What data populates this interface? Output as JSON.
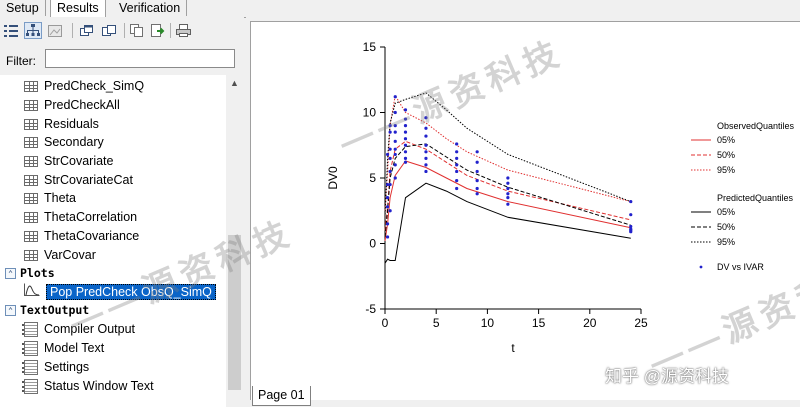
{
  "tabs": [
    {
      "label": "Setup"
    },
    {
      "label": "Results"
    },
    {
      "label": "Verification"
    }
  ],
  "filter": {
    "label": "Filter:",
    "value": ""
  },
  "tree": {
    "tables": [
      "PredCheck_SimQ",
      "PredCheckAll",
      "Residuals",
      "Secondary",
      "StrCovariate",
      "StrCovariateCat",
      "Theta",
      "ThetaCorrelation",
      "ThetaCovariance",
      "VarCovar"
    ],
    "plots_group": "Plots",
    "plot_item": "Pop PredCheck ObsQ_SimQ",
    "textoutput_group": "TextOutput",
    "text_items": [
      "Compiler Output",
      "Model Text",
      "Settings",
      "Status Window Text"
    ]
  },
  "page_tab": "Page 01",
  "chart_data": {
    "type": "line",
    "xlabel": "t",
    "ylabel": "DV0",
    "xlim": [
      0,
      25
    ],
    "ylim": [
      -5,
      15
    ],
    "xticks": [
      0,
      5,
      10,
      15,
      20,
      25
    ],
    "yticks": [
      -5,
      0,
      5,
      10,
      15
    ],
    "legend_observed_title": "ObservedQuantiles",
    "legend_predicted_title": "PredictedQuantiles",
    "legend_points_label": "DV vs IVAR",
    "series": [
      {
        "name": "05%",
        "group": "ObservedQuantiles",
        "color": "#e03030",
        "dash": "solid",
        "x": [
          0,
          0.25,
          0.5,
          1,
          2,
          4,
          6,
          8,
          12,
          24
        ],
        "y": [
          0.2,
          1.5,
          3.5,
          5.2,
          6.3,
          5.8,
          5.0,
          4.2,
          3.2,
          1.2
        ]
      },
      {
        "name": "50%",
        "group": "ObservedQuantiles",
        "color": "#e03030",
        "dash": "dashed",
        "x": [
          0,
          0.25,
          0.5,
          1,
          2,
          4,
          6,
          8,
          12,
          24
        ],
        "y": [
          1.0,
          2.8,
          5.5,
          7.2,
          7.8,
          7.2,
          6.2,
          5.2,
          4.0,
          1.8
        ]
      },
      {
        "name": "95%",
        "group": "ObservedQuantiles",
        "color": "#e03030",
        "dash": "dotted",
        "x": [
          0,
          0.25,
          0.5,
          1,
          2,
          4,
          6,
          8,
          12,
          24
        ],
        "y": [
          2.5,
          5.5,
          9.0,
          11.3,
          10.0,
          9.2,
          8.0,
          7.0,
          5.6,
          3.2
        ]
      },
      {
        "name": "05%",
        "group": "PredictedQuantiles",
        "color": "#000000",
        "dash": "solid",
        "x": [
          0,
          0.25,
          0.5,
          1,
          2,
          4,
          6,
          8,
          12,
          24
        ],
        "y": [
          -1.5,
          -1.2,
          -1.3,
          -1.3,
          3.5,
          4.6,
          4.0,
          3.2,
          2.0,
          0.4
        ]
      },
      {
        "name": "50%",
        "group": "PredictedQuantiles",
        "color": "#000000",
        "dash": "dashed",
        "x": [
          0,
          0.25,
          0.5,
          1,
          2,
          4,
          6,
          8,
          12,
          24
        ],
        "y": [
          0.5,
          2.5,
          5.0,
          6.5,
          7.4,
          7.6,
          6.6,
          5.6,
          4.3,
          1.4
        ]
      },
      {
        "name": "95%",
        "group": "PredictedQuantiles",
        "color": "#000000",
        "dash": "dotted",
        "x": [
          0,
          0.25,
          0.5,
          1,
          2,
          4,
          6,
          8,
          12,
          24
        ],
        "y": [
          2.0,
          6.5,
          9.2,
          10.7,
          11.0,
          11.5,
          10.2,
          8.8,
          6.8,
          3.2
        ]
      }
    ],
    "observed_points": {
      "name": "DV vs IVAR",
      "color": "#2222cc",
      "x": [
        0.25,
        0.25,
        0.25,
        0.25,
        0.25,
        0.25,
        0.5,
        0.5,
        0.5,
        0.5,
        0.5,
        0.5,
        0.5,
        1,
        1,
        1,
        1,
        1,
        1,
        1,
        1,
        1,
        2,
        2,
        2,
        2,
        2,
        2,
        2,
        2,
        2,
        4,
        4,
        4,
        4,
        4,
        4,
        4,
        4,
        7,
        7,
        7,
        7,
        7,
        7,
        7,
        9,
        9,
        9,
        9,
        9,
        9,
        12,
        12,
        12,
        12,
        12,
        12,
        24,
        24,
        24,
        24,
        24,
        24
      ],
      "y": [
        0.5,
        1.5,
        2.8,
        3.5,
        4.5,
        6.8,
        2.5,
        4.5,
        5.5,
        6.5,
        7.2,
        8.5,
        9.0,
        5.0,
        6.0,
        6.8,
        7.2,
        7.8,
        8.5,
        9.0,
        10.0,
        11.2,
        6.2,
        6.5,
        7.0,
        7.5,
        8.0,
        8.5,
        9.0,
        9.5,
        10.2,
        5.5,
        6.0,
        6.5,
        7.0,
        7.5,
        8.2,
        8.8,
        9.6,
        4.2,
        4.8,
        5.5,
        6.0,
        6.5,
        7.0,
        7.6,
        3.8,
        4.2,
        4.8,
        5.5,
        6.2,
        7.0,
        3.0,
        3.5,
        3.8,
        4.2,
        4.6,
        5.0,
        0.9,
        1.0,
        1.1,
        1.3,
        2.2,
        3.2
      ]
    }
  },
  "watermark_text": "源资科技",
  "zh_mark": "知乎 @源资科技"
}
